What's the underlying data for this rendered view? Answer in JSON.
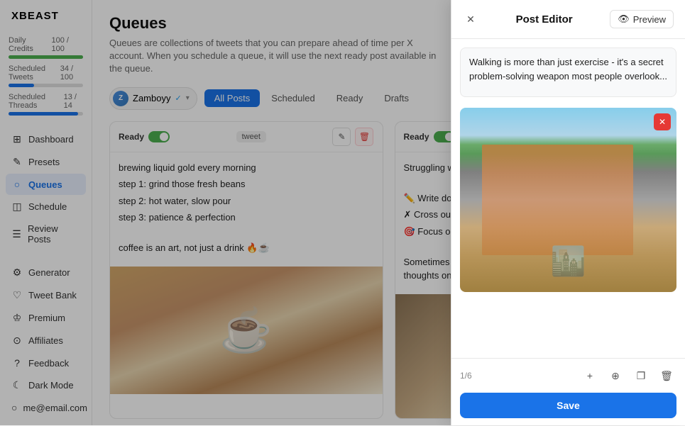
{
  "app": {
    "logo": "XBEAST"
  },
  "sidebar": {
    "nav_items": [
      {
        "id": "dashboard",
        "label": "Dashboard",
        "icon": "⊞"
      },
      {
        "id": "presets",
        "label": "Presets",
        "icon": "✎"
      },
      {
        "id": "queues",
        "label": "Queues",
        "icon": "○",
        "active": true
      },
      {
        "id": "schedule",
        "label": "Schedule",
        "icon": "◫"
      },
      {
        "id": "review-posts",
        "label": "Review Posts",
        "icon": "☰"
      }
    ],
    "bottom_items": [
      {
        "id": "generator",
        "label": "Generator",
        "icon": "⚙"
      },
      {
        "id": "tweet-bank",
        "label": "Tweet Bank",
        "icon": "♡"
      },
      {
        "id": "premium",
        "label": "Premium",
        "icon": "♔"
      },
      {
        "id": "affiliates",
        "label": "Affiliates",
        "icon": "⊙"
      },
      {
        "id": "feedback",
        "label": "Feedback",
        "icon": "?"
      },
      {
        "id": "dark-mode",
        "label": "Dark Mode",
        "icon": "☾"
      },
      {
        "id": "account",
        "label": "me@email.com",
        "icon": "○"
      }
    ],
    "credits": {
      "daily_label": "Daily Credits",
      "daily_value": "100 / 100",
      "daily_fill": 100,
      "daily_color": "#4caf50",
      "scheduled_label": "Scheduled Tweets",
      "scheduled_value": "34 / 100",
      "scheduled_fill": 34,
      "scheduled_color": "#1a73e8",
      "threads_label": "Scheduled Threads",
      "threads_value": "13 / 14",
      "threads_fill": 93,
      "threads_color": "#1a73e8"
    }
  },
  "main": {
    "title": "Queues",
    "subtitle": "Queues are collections of tweets that you can prepare ahead of time per X account. When you schedule a queue, it will use the next ready post available in the queue.",
    "account": {
      "name": "Zamboyy",
      "verified": true
    },
    "tabs": [
      {
        "id": "all-posts",
        "label": "All Posts",
        "active": true
      },
      {
        "id": "scheduled",
        "label": "Scheduled"
      },
      {
        "id": "ready",
        "label": "Ready"
      },
      {
        "id": "drafts",
        "label": "Drafts"
      }
    ],
    "posts": [
      {
        "id": "post-1",
        "status": "Ready",
        "type": "tweet",
        "text": "brewing liquid gold every morning\n\nstep 1: grind those fresh beans\nstep 2: hot water, slow pour\nstep 3: patience & perfection\n\ncoffee is an art, not just a drink 🔥☕",
        "has_image": true,
        "image_type": "coffee"
      },
      {
        "id": "post-2",
        "status": "Ready",
        "type": "tweet",
        "text": "Struggling with mental clarity?\n\n✏️ Write down all thoughts\n✗ Cross out distractions\n🎯 Focus on what matters\n\nSometimes clearing your mind is as simple as organizing your thoughts on paper.",
        "has_image": true,
        "image_type": "book"
      }
    ]
  },
  "editor": {
    "title": "Post Editor",
    "close_label": "×",
    "preview_label": "Preview",
    "preview_icon": "👁",
    "text": "Walking is more than just exercise - it's a secret problem-solving weapon most people overlook...",
    "image_type": "street",
    "page_current": 1,
    "page_total": 6,
    "page_label": "1/6",
    "actions": {
      "add_label": "+",
      "move_label": "⊕",
      "copy_label": "❐",
      "delete_label": "🗑"
    },
    "save_label": "Save",
    "img_delete_label": "✕"
  }
}
